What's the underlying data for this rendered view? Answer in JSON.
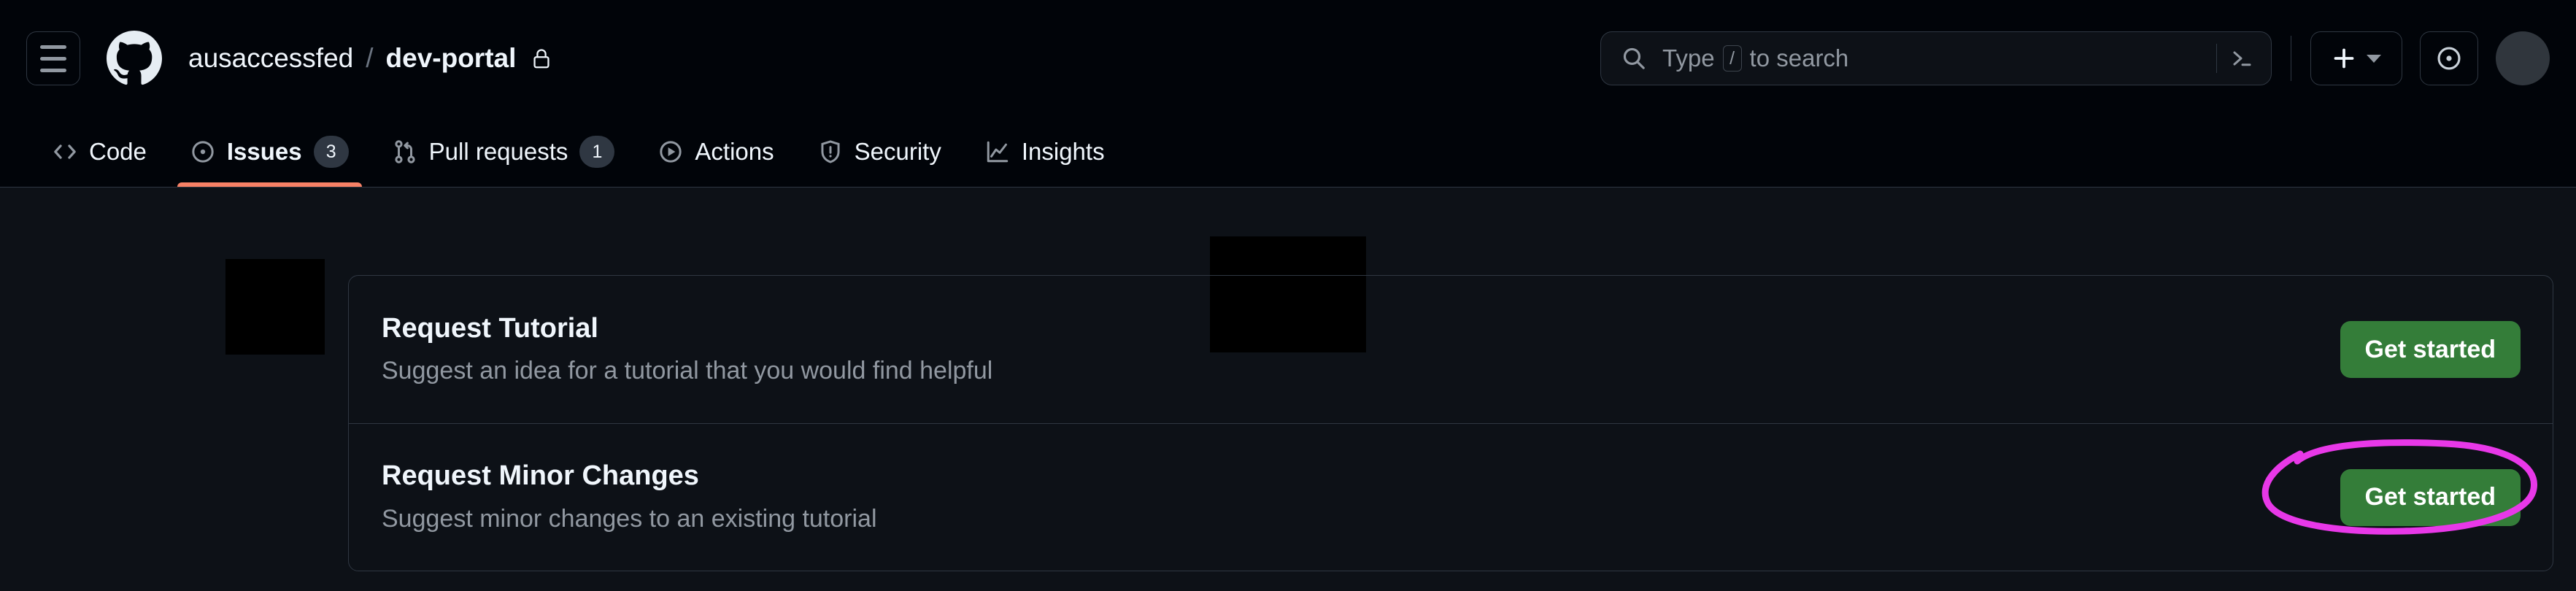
{
  "header": {
    "hamburger_label": "Open navigation menu",
    "logo_name": "github-logo",
    "breadcrumb": {
      "owner": "ausaccessfed",
      "separator": "/",
      "repo": "dev-portal",
      "visibility_icon": "lock-icon"
    },
    "search": {
      "icon": "search-icon",
      "placeholder_prefix": "Type",
      "placeholder_key": "/",
      "placeholder_suffix": "to search",
      "terminal_icon": "terminal-icon"
    },
    "actions": {
      "create_new_label": "+",
      "create_new_icon": "plus-icon",
      "create_new_caret": "chevron-down-icon",
      "issues_icon": "issue-opened-icon",
      "avatar_icon": "avatar"
    }
  },
  "nav": {
    "tabs": [
      {
        "label": "Code",
        "icon": "code-icon",
        "count": null,
        "active": false
      },
      {
        "label": "Issues",
        "icon": "issue-opened-icon",
        "count": "3",
        "active": true
      },
      {
        "label": "Pull requests",
        "icon": "git-pull-request-icon",
        "count": "1",
        "active": false
      },
      {
        "label": "Actions",
        "icon": "play-icon",
        "count": null,
        "active": false
      },
      {
        "label": "Security",
        "icon": "shield-icon",
        "count": null,
        "active": false
      },
      {
        "label": "Insights",
        "icon": "graph-icon",
        "count": null,
        "active": false
      }
    ]
  },
  "main": {
    "templates": [
      {
        "title": "Request Tutorial",
        "description": "Suggest an idea for a tutorial that you would find helpful",
        "button_label": "Get started",
        "annotated": false
      },
      {
        "title": "Request Minor Changes",
        "description": "Suggest minor changes to an existing tutorial",
        "button_label": "Get started",
        "annotated": true
      }
    ]
  },
  "annotation": {
    "shape": "ellipse-circle",
    "color": "#e838e8",
    "targets": "second-get-started-button"
  },
  "colors": {
    "page_background": "#0d1117",
    "header_background": "#010409",
    "border": "#2f3742",
    "text_primary": "#f0f6fc",
    "text_muted": "#9198a1",
    "accent_underline": "#f78166",
    "button_green": "#347d39",
    "annotation_magenta": "#e838e8",
    "redaction": "#000000"
  }
}
